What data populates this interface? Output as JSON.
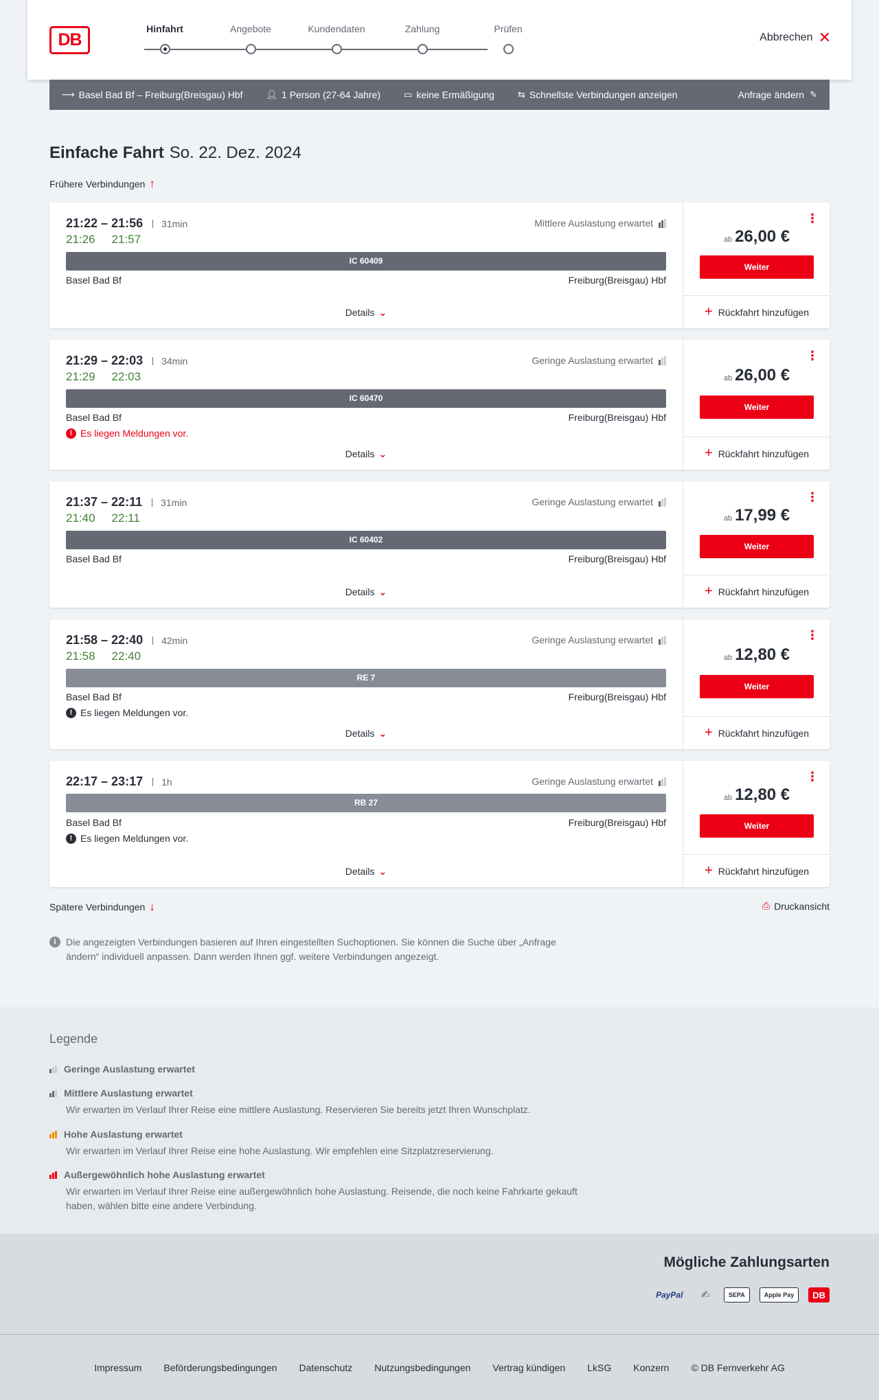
{
  "header": {
    "logo": "DB",
    "steps": [
      "Hinfahrt",
      "Angebote",
      "Kundendaten",
      "Zahlung",
      "Prüfen"
    ],
    "active_step": "Hinfahrt",
    "cancel_label": "Abbrechen"
  },
  "search": {
    "route": "Basel Bad Bf – Freiburg(Breisgau) Hbf",
    "passengers": "1 Person (27-64 Jahre)",
    "discount": "keine Ermäßigung",
    "option": "Schnellste Verbindungen anzeigen",
    "edit": "Anfrage ändern"
  },
  "page": {
    "title": "Einfache Fahrt",
    "date": "So. 22. Dez. 2024",
    "earlier": "Frühere Verbindungen",
    "later": "Spätere Verbindungen",
    "print": "Druckansicht",
    "info": "Die angezeigten Verbindungen basieren auf Ihren eingestellten Suchoptionen. Sie können die Suche über „Anfrage ändern“ individuell anpassen. Dann werden Ihnen ggf. weitere Verbindungen angezeigt."
  },
  "connections": [
    {
      "times": "21:22 – 21:56",
      "duration": "31min",
      "rt_dep": "21:26",
      "rt_arr": "21:57",
      "load": "Mittlere Auslastung erwartet",
      "load_level": 2,
      "train": "IC 60409",
      "train_kind": "ic",
      "from": "Basel Bad Bf",
      "to": "Freiburg(Breisgau) Hbf",
      "message": "",
      "message_kind": "",
      "price_prefix": "ab",
      "price": "26,00 €",
      "button": "Weiter",
      "return": "Rückfahrt hinzufügen",
      "details": "Details"
    },
    {
      "times": "21:29 – 22:03",
      "duration": "34min",
      "rt_dep": "21:29",
      "rt_arr": "22:03",
      "load": "Geringe Auslastung erwartet",
      "load_level": 1,
      "train": "IC 60470",
      "train_kind": "ic",
      "from": "Basel Bad Bf",
      "to": "Freiburg(Breisgau) Hbf",
      "message": "Es liegen Meldungen vor.",
      "message_kind": "red",
      "price_prefix": "ab",
      "price": "26,00 €",
      "button": "Weiter",
      "return": "Rückfahrt hinzufügen",
      "details": "Details"
    },
    {
      "times": "21:37 – 22:11",
      "duration": "31min",
      "rt_dep": "21:40",
      "rt_arr": "22:11",
      "load": "Geringe Auslastung erwartet",
      "load_level": 1,
      "train": "IC 60402",
      "train_kind": "ic",
      "from": "Basel Bad Bf",
      "to": "Freiburg(Breisgau) Hbf",
      "message": "",
      "message_kind": "",
      "price_prefix": "ab",
      "price": "17,99 €",
      "button": "Weiter",
      "return": "Rückfahrt hinzufügen",
      "details": "Details"
    },
    {
      "times": "21:58 – 22:40",
      "duration": "42min",
      "rt_dep": "21:58",
      "rt_arr": "22:40",
      "load": "Geringe Auslastung erwartet",
      "load_level": 1,
      "train": "RE 7",
      "train_kind": "re",
      "from": "Basel Bad Bf",
      "to": "Freiburg(Breisgau) Hbf",
      "message": "Es liegen Meldungen vor.",
      "message_kind": "dark",
      "price_prefix": "ab",
      "price": "12,80 €",
      "button": "Weiter",
      "return": "Rückfahrt hinzufügen",
      "details": "Details"
    },
    {
      "times": "22:17 – 23:17",
      "duration": "1h",
      "rt_dep": "",
      "rt_arr": "",
      "load": "Geringe Auslastung erwartet",
      "load_level": 1,
      "train": "RB 27",
      "train_kind": "re",
      "from": "Basel Bad Bf",
      "to": "Freiburg(Breisgau) Hbf",
      "message": "Es liegen Meldungen vor.",
      "message_kind": "dark",
      "price_prefix": "ab",
      "price": "12,80 €",
      "button": "Weiter",
      "return": "Rückfahrt hinzufügen",
      "details": "Details"
    }
  ],
  "legend": {
    "title": "Legende",
    "items": [
      {
        "label": "Geringe Auslastung erwartet",
        "text": "",
        "color": "#646973"
      },
      {
        "label": "Mittlere Auslastung erwartet",
        "text": "Wir erwarten im Verlauf Ihrer Reise eine mittlere Auslastung. Reservieren Sie bereits jetzt Ihren Wunschplatz.",
        "color": "#646973"
      },
      {
        "label": "Hohe Auslastung erwartet",
        "text": "Wir erwarten im Verlauf Ihrer Reise eine hohe Auslastung. Wir empfehlen eine Sitzplatzreservierung.",
        "color": "#f39200"
      },
      {
        "label": "Außergewöhnlich hohe Auslastung erwartet",
        "text": "Wir erwarten im Verlauf Ihrer Reise eine außergewöhnlich hohe Auslastung. Reisende, die noch keine Fahrkarte gekauft haben, wählen bitte eine andere Verbindung.",
        "color": "#ec0016"
      }
    ]
  },
  "payment": {
    "title": "Mögliche Zahlungsarten",
    "methods": [
      "PayPal",
      "Lastschrift",
      "SEPA",
      "Apple Pay",
      "DB"
    ]
  },
  "footer": {
    "links": [
      "Impressum",
      "Beförderungsbedingungen",
      "Datenschutz",
      "Nutzungsbedingungen",
      "Vertrag kündigen",
      "LkSG",
      "Konzern",
      "© DB Fernverkehr AG"
    ]
  }
}
